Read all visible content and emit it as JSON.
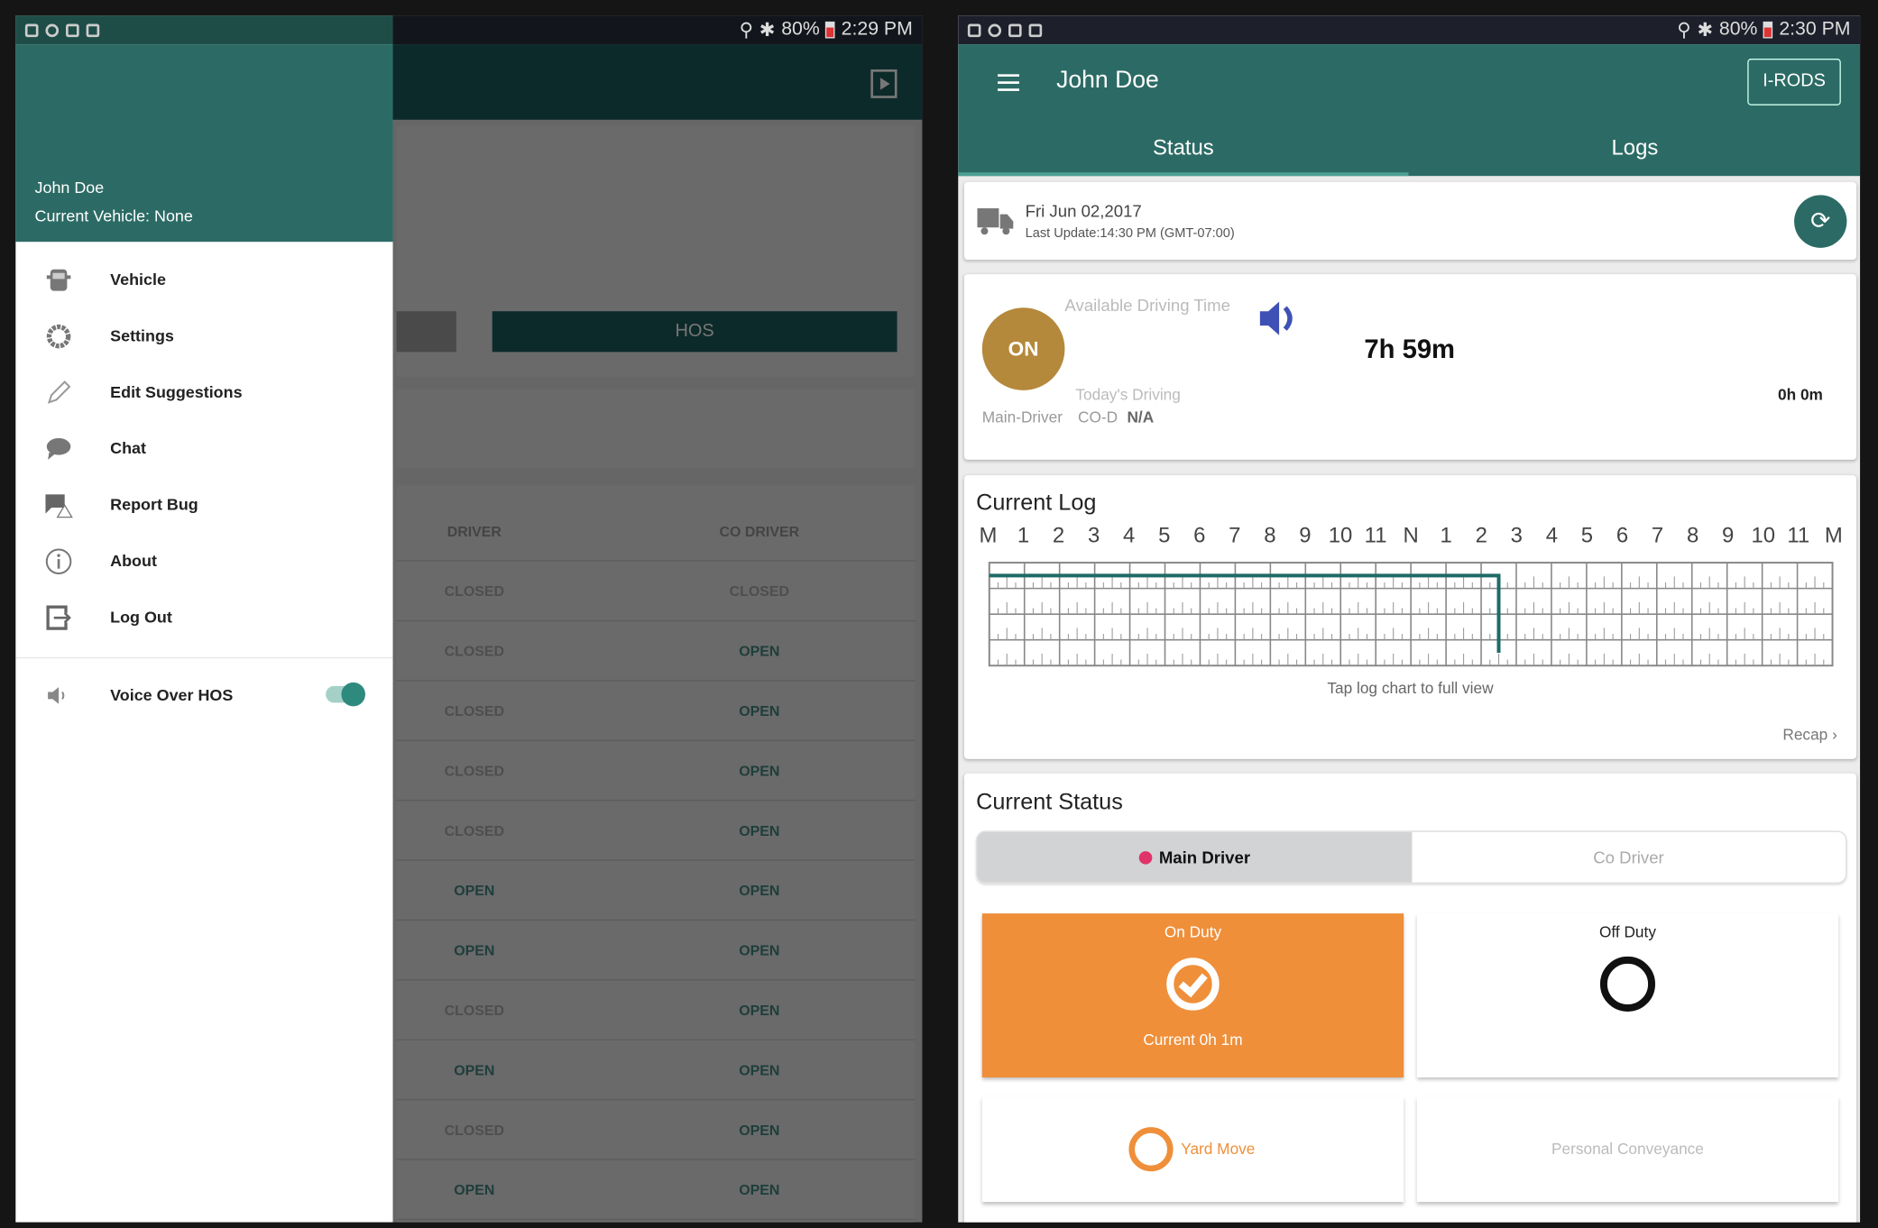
{
  "left_screen": {
    "status_bar": {
      "battery": "80%",
      "time": "2:29 PM"
    },
    "drawer": {
      "user_name": "John Doe",
      "current_vehicle": "Current Vehicle: None",
      "items": [
        {
          "label": "Vehicle",
          "icon": "vehicle-icon"
        },
        {
          "label": "Settings",
          "icon": "gear-icon"
        },
        {
          "label": "Edit Suggestions",
          "icon": "pencil-icon"
        },
        {
          "label": "Chat",
          "icon": "chat-icon"
        },
        {
          "label": "Report Bug",
          "icon": "report-bug-icon"
        },
        {
          "label": "About",
          "icon": "info-icon"
        },
        {
          "label": "Log Out",
          "icon": "logout-icon"
        }
      ],
      "voice_over": {
        "label": "Voice Over HOS",
        "enabled": true
      }
    },
    "background": {
      "hos_button": "HOS",
      "table": {
        "headers": [
          "DRIVER",
          "CO DRIVER"
        ],
        "rows": [
          [
            "CLOSED",
            "CLOSED"
          ],
          [
            "CLOSED",
            "OPEN"
          ],
          [
            "CLOSED",
            "OPEN"
          ],
          [
            "CLOSED",
            "OPEN"
          ],
          [
            "CLOSED",
            "OPEN"
          ],
          [
            "OPEN",
            "OPEN"
          ],
          [
            "OPEN",
            "OPEN"
          ],
          [
            "CLOSED",
            "OPEN"
          ],
          [
            "OPEN",
            "OPEN"
          ],
          [
            "CLOSED",
            "OPEN"
          ],
          [
            "OPEN",
            "OPEN"
          ]
        ]
      }
    }
  },
  "right_screen": {
    "status_bar": {
      "battery": "80%",
      "time": "2:30 PM"
    },
    "header": {
      "title": "John Doe",
      "irods_button": "I-RODS"
    },
    "tabs": [
      {
        "label": "Status",
        "active": true
      },
      {
        "label": "Logs",
        "active": false
      }
    ],
    "date_card": {
      "date": "Fri Jun 02,2017",
      "last_update": "Last Update:14:30 PM (GMT-07:00)"
    },
    "driving_card": {
      "status_badge": "ON",
      "available_label": "Available Driving Time",
      "available_value": "7h 59m",
      "todays_label": "Today's Driving",
      "todays_value": "0h 0m",
      "main_driver": "Main-Driver",
      "co_driver_label": "CO-D",
      "co_driver_value": "N/A"
    },
    "current_log": {
      "title": "Current Log",
      "hint": "Tap log chart to full view",
      "recap": "Recap"
    },
    "current_status": {
      "title": "Current Status",
      "segments": [
        {
          "label": "Main Driver",
          "selected": true
        },
        {
          "label": "Co Driver",
          "selected": false
        }
      ],
      "on_duty": {
        "label": "On Duty",
        "current": "Current 0h 1m"
      },
      "off_duty": {
        "label": "Off Duty"
      },
      "yard_move": {
        "label": "Yard Move"
      },
      "personal_conveyance": {
        "label": "Personal Conveyance"
      }
    },
    "colors": {
      "teal": "#2c6b65",
      "orange": "#ef8f3a",
      "on_badge": "#b5893b",
      "log_line": "#1e6b66"
    }
  },
  "chart_data": {
    "type": "line",
    "x_tick_labels": [
      "M",
      "1",
      "2",
      "3",
      "4",
      "5",
      "6",
      "7",
      "8",
      "9",
      "10",
      "11",
      "N",
      "1",
      "2",
      "3",
      "4",
      "5",
      "6",
      "7",
      "8",
      "9",
      "10",
      "11",
      "M"
    ],
    "xlim": [
      0,
      24
    ],
    "rows": 4,
    "series": [
      {
        "points": [
          [
            0,
            1
          ],
          [
            14.5,
            1
          ],
          [
            14.5,
            4
          ]
        ]
      }
    ]
  }
}
